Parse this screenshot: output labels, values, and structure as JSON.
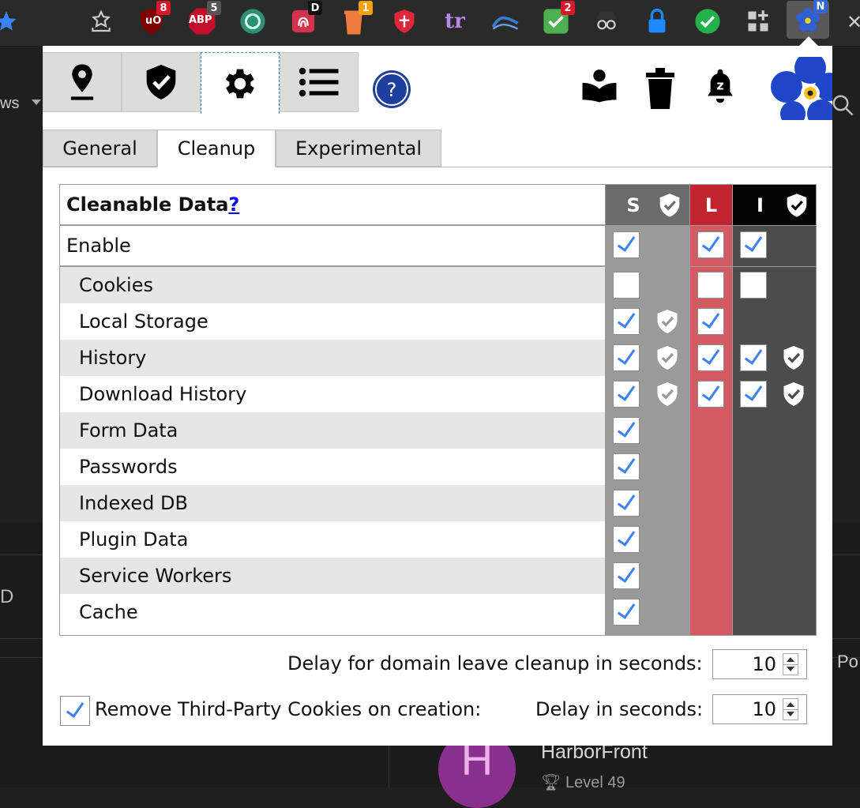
{
  "toolbar": {
    "badges": {
      "ublock": "8",
      "abp": "5",
      "lastpass_d": "D",
      "trash": "1",
      "todo": "2",
      "active_ext": "N"
    },
    "abp_label": "ABP",
    "ublock_label": "uO",
    "tr_label": "tr"
  },
  "background": {
    "left_text": "ws",
    "left_letter": "D",
    "right_text": "Po",
    "avatar_letter": "H",
    "user_name": "HarborFront",
    "user_level": "Level 49"
  },
  "nav": {
    "tabs": [
      "location-icon",
      "shield-check-icon",
      "gear-icon",
      "list-icon"
    ],
    "active_tab": "settings"
  },
  "subtabs": {
    "general": "General",
    "cleanup": "Cleanup",
    "experimental": "Experimental",
    "active": "Cleanup"
  },
  "table": {
    "header_label": "Cleanable Data",
    "help_link": "?",
    "col_s": "S",
    "col_l": "L",
    "col_i": "I",
    "enable_label": "Enable",
    "rows": [
      {
        "label": "Cookies"
      },
      {
        "label": "Local Storage"
      },
      {
        "label": "History"
      },
      {
        "label": "Download History"
      },
      {
        "label": "Form Data"
      },
      {
        "label": "Passwords"
      },
      {
        "label": "Indexed DB"
      },
      {
        "label": "Plugin Data"
      },
      {
        "label": "Service Workers"
      },
      {
        "label": "Cache"
      }
    ]
  },
  "bottom": {
    "domain_leave_label": "Delay for domain leave cleanup in seconds:",
    "domain_leave_value": "10",
    "third_party_label": "Remove Third-Party Cookies on creation:",
    "delay_label": "Delay in seconds:",
    "delay_value": "10"
  },
  "colors": {
    "s_header": "#6b6b6b",
    "s_body": "#9a9a9a",
    "l_header": "#c1242f",
    "l_body": "#d35a63",
    "i_header": "#050505",
    "i_body": "#4c4c4c",
    "check": "#3a82f7"
  }
}
